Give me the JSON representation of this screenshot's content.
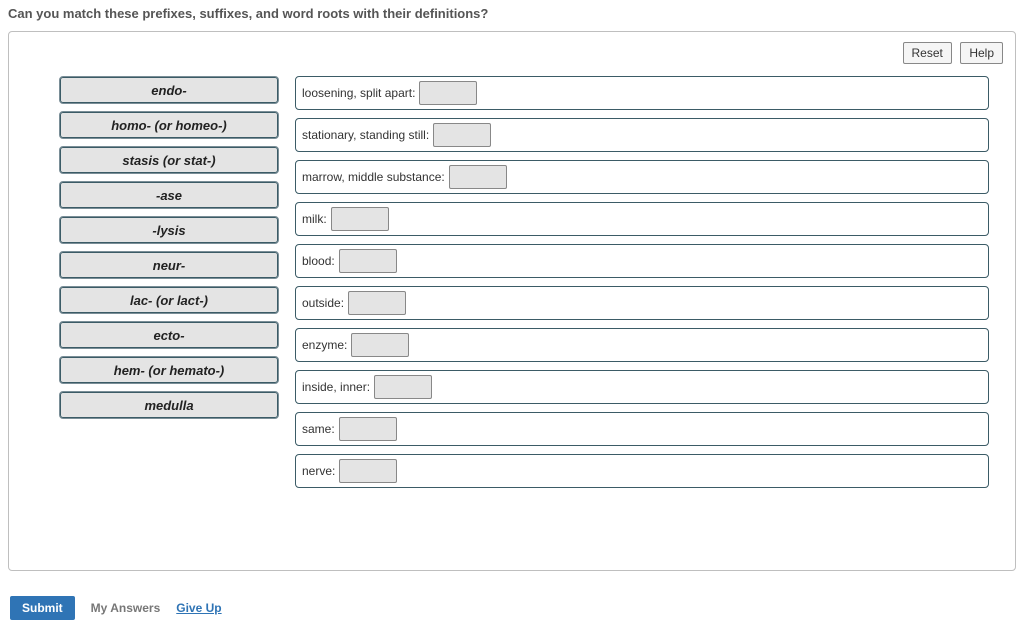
{
  "prompt": "Can you match these prefixes, suffixes, and word roots with their definitions?",
  "toolbar": {
    "reset_label": "Reset",
    "help_label": "Help"
  },
  "terms": [
    "endo-",
    "homo- (or homeo-)",
    "stasis (or stat-)",
    "-ase",
    "-lysis",
    "neur-",
    "lac- (or lact-)",
    "ecto-",
    "hem- (or hemato-)",
    "medulla"
  ],
  "definitions": [
    "loosening, split apart:",
    "stationary, standing still:",
    "marrow, middle substance:",
    "milk:",
    "blood:",
    "outside:",
    "enzyme:",
    "inside, inner:",
    "same:",
    "nerve:"
  ],
  "footer": {
    "submit_label": "Submit",
    "my_answers_label": "My Answers",
    "give_up_label": "Give Up"
  }
}
